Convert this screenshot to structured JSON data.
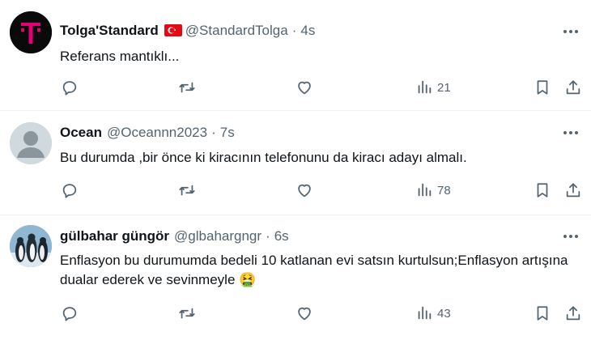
{
  "tweets": [
    {
      "name": "Tolga'Standard",
      "has_flag": true,
      "handle": "@StandardTolga",
      "separator": "·",
      "time": "4s",
      "text": "Referans mantıklı...",
      "views": "21",
      "avatar": "magenta-t-logo"
    },
    {
      "name": "Ocean",
      "has_flag": false,
      "handle": "@Oceannn2023",
      "separator": "·",
      "time": "7s",
      "text": "Bu durumda ,bir önce ki kiracının telefonunu da kiracı adayı almalı.",
      "views": "78",
      "avatar": "default-profile"
    },
    {
      "name": "gülbahar güngör",
      "has_flag": false,
      "handle": "@glbahargngr",
      "separator": "·",
      "time": "6s",
      "text": "Enflasyon bu durumumda bedeli 10 katlanan evi satsın kurtulsun;Enflasyon artışına dualar ederek ve sevinmeyle 🤮",
      "views": "43",
      "avatar": "penguins-photo"
    }
  ],
  "icons": {
    "more": "more-horizontal-icon",
    "reply": "reply-icon",
    "retweet": "retweet-icon",
    "like": "like-icon",
    "views": "views-icon",
    "bookmark": "bookmark-icon",
    "share": "share-icon"
  },
  "colors": {
    "text": "#0f1419",
    "secondary": "#536471",
    "divider": "#eff3f4",
    "magenta": "#e20074"
  }
}
